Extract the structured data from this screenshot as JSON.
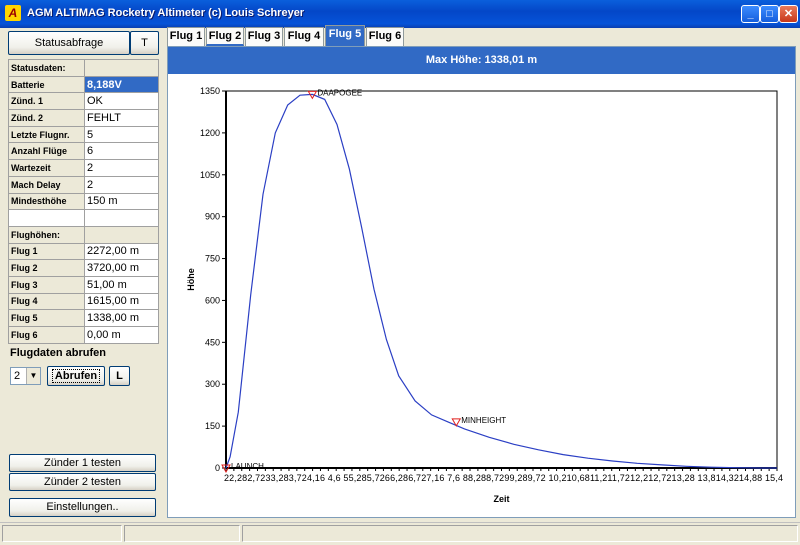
{
  "window": {
    "title": "AGM ALTIMAG Rocketry Altimeter     (c) Louis Schreyer",
    "app_icon": "altimag-logo-icon",
    "minimize_label": "_",
    "maximize_label": "□",
    "close_label": "✕"
  },
  "left": {
    "status_button": "Statusabfrage",
    "t_button": "T",
    "status_rows": [
      {
        "label": "Statusdaten:",
        "value": ""
      },
      {
        "label": "Batterie",
        "value": "8,188V"
      },
      {
        "label": "Zünd. 1",
        "value": "OK"
      },
      {
        "label": "Zünd. 2",
        "value": "FEHLT"
      },
      {
        "label": "Letzte Flugnr.",
        "value": "5"
      },
      {
        "label": "Anzahl Flüge",
        "value": "6"
      },
      {
        "label": "Wartezeit",
        "value": "2"
      },
      {
        "label": "Mach Delay",
        "value": "2"
      },
      {
        "label": "Mindesthöhe",
        "value": "150 m"
      },
      {
        "label": "",
        "value": ""
      },
      {
        "label": "Flughöhen:",
        "value": ""
      },
      {
        "label": "Flug 1",
        "value": "2272,00 m"
      },
      {
        "label": "Flug 2",
        "value": "3720,00 m"
      },
      {
        "label": "Flug 3",
        "value": "51,00 m"
      },
      {
        "label": "Flug 4",
        "value": "1615,00 m"
      },
      {
        "label": "Flug 5",
        "value": "1338,00 m"
      },
      {
        "label": "Flug 6",
        "value": "0,00 m"
      }
    ],
    "flugdaten_label": "Flugdaten abrufen",
    "flight_select_value": "2",
    "abrufen_button": "Abrufen",
    "l_button": "L",
    "zuender1_button": "Zünder 1 testen",
    "zuender2_button": "Zünder 2 testen",
    "einstellungen_button": "Einstellungen.."
  },
  "tabs": [
    "Flug 1",
    "Flug 2",
    "Flug 3",
    "Flug 4",
    "Flug 5",
    "Flug 6"
  ],
  "active_tab": "Flug 5",
  "banner": "Max Höhe: 1338,01 m",
  "colors": {
    "accent": "#316ac5",
    "line": "#2b3fc4",
    "marker": "#e0201e"
  },
  "chart_data": {
    "type": "line",
    "title": "",
    "xlabel": "Zeit",
    "ylabel": "Höhe",
    "ylim": [
      0,
      1350
    ],
    "yticks": [
      0,
      150,
      300,
      450,
      600,
      750,
      900,
      1050,
      1200,
      1350
    ],
    "xtick_labels": [
      "2",
      "2,28",
      "2,72",
      "33",
      "2,83",
      "3,72",
      "4,16",
      "4,6",
      "5",
      "5,28",
      "5,72",
      "6",
      "6,28",
      "6,72",
      "7,16",
      "7,6",
      "8",
      "8,28",
      "8,72",
      "9",
      "9,28",
      "9,72",
      "10",
      "10,28",
      "10,68",
      "11,2",
      "11,72",
      "12",
      "12,72",
      "13,28",
      "13,8",
      "14,32",
      "14,8",
      "15,4"
    ],
    "xtick_label_text": "22,282,7233,283,724,16 4,6   55,285,7266,286,727,16 7,6   88,288,7299,289,72 10,210,6811,211,7212,212,7213,28 13,814,3214,88 15,4",
    "grid": false,
    "series": [
      {
        "values": [
          [
            2,
            0
          ],
          [
            2.1,
            40
          ],
          [
            2.3,
            200
          ],
          [
            2.6,
            620
          ],
          [
            2.9,
            980
          ],
          [
            3.2,
            1200
          ],
          [
            3.5,
            1300
          ],
          [
            3.8,
            1335
          ],
          [
            4.1,
            1338
          ],
          [
            4.4,
            1320
          ],
          [
            4.7,
            1230
          ],
          [
            5.0,
            1070
          ],
          [
            5.3,
            860
          ],
          [
            5.6,
            640
          ],
          [
            5.9,
            460
          ],
          [
            6.2,
            330
          ],
          [
            6.6,
            240
          ],
          [
            7.0,
            190
          ],
          [
            7.4,
            165
          ],
          [
            7.8,
            140
          ],
          [
            8.4,
            110
          ],
          [
            9.0,
            85
          ],
          [
            9.6,
            65
          ],
          [
            10.2,
            48
          ],
          [
            10.8,
            35
          ],
          [
            11.4,
            25
          ],
          [
            12.0,
            17
          ],
          [
            12.6,
            11
          ],
          [
            13.2,
            6
          ],
          [
            13.8,
            3
          ],
          [
            14.4,
            1
          ],
          [
            15.0,
            0
          ],
          [
            15.4,
            0
          ]
        ]
      }
    ],
    "annotations": [
      {
        "label": "LAUNCH",
        "x": 2,
        "y": 0
      },
      {
        "label": "APOGEE",
        "x": 4.1,
        "y": 1338
      },
      {
        "label": "MINHEIGHT",
        "x": 7.6,
        "y": 165
      }
    ],
    "apogee_extra_label": "DA"
  },
  "statusbar": {
    "pane1": "",
    "pane2": "",
    "pane3": ""
  }
}
